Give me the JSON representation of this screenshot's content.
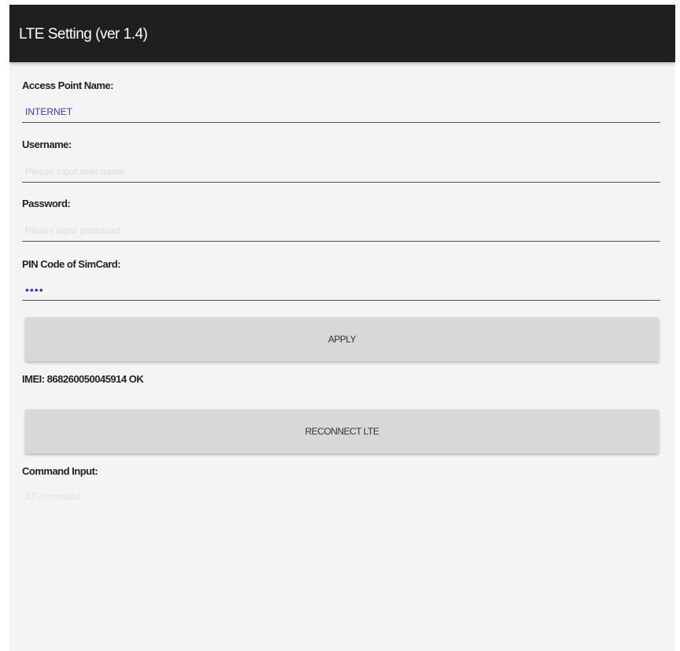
{
  "app": {
    "title": "LTE Setting (ver 1.4)"
  },
  "form": {
    "apn_label": "Access Point Name:",
    "apn_value": "INTERNET",
    "username_label": "Username:",
    "username_placeholder": "Please input user name",
    "password_label": "Password:",
    "password_placeholder": "Please input password",
    "pin_label": "PIN Code of SimCard:",
    "pin_value": "••••",
    "apply_label": "APPLY"
  },
  "status": {
    "imei_text": "IMEI: 868260050045914 OK"
  },
  "actions": {
    "reconnect_label": "RECONNECT LTE"
  },
  "command": {
    "label": "Command Input:",
    "placeholder": "AT command"
  },
  "colors": {
    "titlebar": "#1f1f1f",
    "background": "#f4f4f4",
    "input_text": "#3a35c8",
    "button": "#d8d8d8"
  }
}
